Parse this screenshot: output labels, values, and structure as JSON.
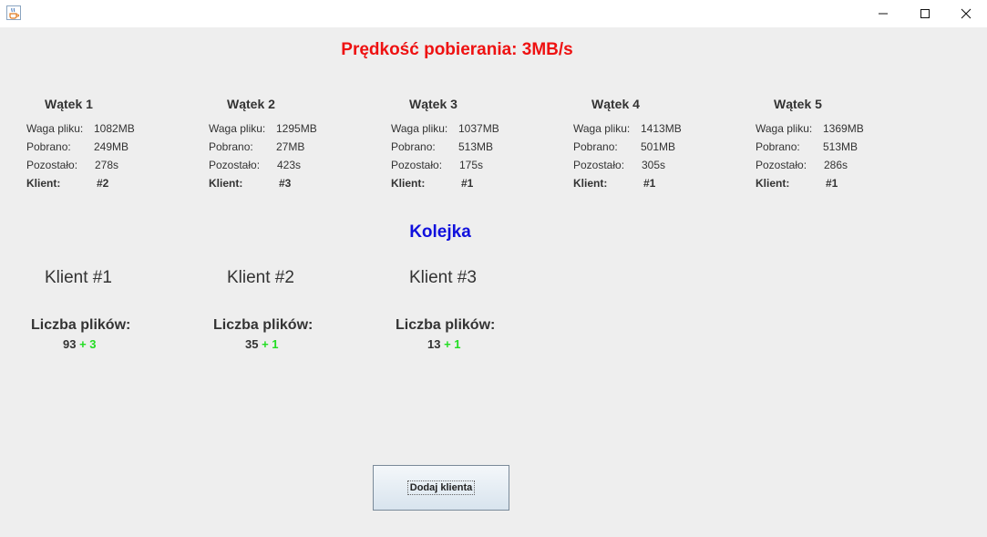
{
  "window": {
    "icon": "java-cup-icon",
    "controls": [
      "minimize-icon",
      "maximize-icon",
      "close-icon"
    ]
  },
  "speed_text": "Prędkość pobierania: 3MB/s",
  "labels": {
    "size": "Waga pliku:",
    "downloaded": "Pobrano:",
    "remaining": "Pozostało:",
    "client": "Klient:"
  },
  "threads": [
    {
      "title": "Wątek 1",
      "size": "1082MB",
      "downloaded": "249MB",
      "remaining": "278s",
      "client": "#2"
    },
    {
      "title": "Wątek 2",
      "size": "1295MB",
      "downloaded": "27MB",
      "remaining": "423s",
      "client": "#3"
    },
    {
      "title": "Wątek 3",
      "size": "1037MB",
      "downloaded": "513MB",
      "remaining": "175s",
      "client": "#1"
    },
    {
      "title": "Wątek 4",
      "size": "1413MB",
      "downloaded": "501MB",
      "remaining": "305s",
      "client": "#1"
    },
    {
      "title": "Wątek 5",
      "size": "1369MB",
      "downloaded": "513MB",
      "remaining": "286s",
      "client": "#1"
    }
  ],
  "queue_title": "Kolejka",
  "files_label": "Liczba plików:",
  "clients": [
    {
      "title": "Klient #1",
      "files": "93",
      "plus": "+ 3"
    },
    {
      "title": "Klient #2",
      "files": "35",
      "plus": "+ 1"
    },
    {
      "title": "Klient #3",
      "files": "13",
      "plus": "+ 1"
    }
  ],
  "add_button": "Dodaj klienta",
  "colors": {
    "speed": "#ee1111",
    "queue": "#1010dd",
    "plus": "#22dd22"
  }
}
